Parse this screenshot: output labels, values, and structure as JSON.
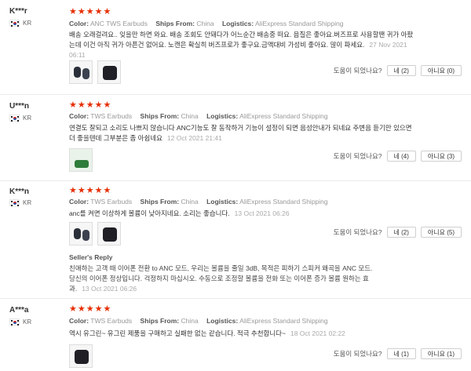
{
  "labels": {
    "color": "Color:",
    "ships_from": "Ships From:",
    "logistics": "Logistics:",
    "helpful_question": "도움이 되었나요?",
    "seller_reply": "Seller's Reply",
    "stars": "★★★★★"
  },
  "reviews": [
    {
      "user": "K***r",
      "country": "KR",
      "rating": 5,
      "color": "ANC TWS Earbuds",
      "ships_from": "China",
      "logistics": "AliExpress Standard Shipping",
      "text": "배송 오래걸려요.. 잊을만 하면 와요. 배송 조회도 안돼다가 어느순간 배송중 떠요. 음질은 좋아요.버즈프로 사용할땐 귀가 아팠는데 이건 아직 귀가 아픈건 없어요. 노캔은 확실히 버즈프로가 좋구요.금액대비 가성비 좋아요. 많이 파세요.",
      "date": "27 Nov 2021 06:11",
      "yes": "네 (2)",
      "no": "아니요 (0)"
    },
    {
      "user": "U***n",
      "country": "KR",
      "rating": 5,
      "color": "TWS Earbuds",
      "ships_from": "China",
      "logistics": "AliExpress Standard Shipping",
      "text": "연결도 잘되고 소리도 나쁘지 않습니다 ANC기능도 잘 동작하거 기능이 설정이 되면 음성안내가 되네요 주변음 듣기만 있으면 더 좋을텐데 그부분은 좀 아쉽네요",
      "date": "12 Oct 2021 21:41",
      "yes": "네 (4)",
      "no": "아니요 (3)"
    },
    {
      "user": "K***n",
      "country": "KR",
      "rating": 5,
      "color": "TWS Earbuds",
      "ships_from": "China",
      "logistics": "AliExpress Standard Shipping",
      "text": "anc를 켜면 이상하게 볼륨이 낮아지네요. 소리는 좋습니다.",
      "date": "13 Oct 2021 06:26",
      "yes": "네 (2)",
      "no": "아니요 (5)",
      "seller_reply": "친애하는 고객 때 이어폰 전환 to ANC 모드, 우리는 볼륨을 줄일 3dB, 목적은 피하기 스피커 왜곡을 ANC 모드. 당신의 이어폰 정상입니다. 걱정하지 마십시오. 수동으로 조정할 볼륨을 전화 또는 이어폰 증가 볼륨 원하는 효과.",
      "seller_date": "13 Oct 2021 06:26"
    },
    {
      "user": "A***a",
      "country": "KR",
      "rating": 5,
      "color": "TWS Earbuds",
      "ships_from": "China",
      "logistics": "AliExpress Standard Shipping",
      "text": "역시 유그린~ 유그린 제품을 구매하고 실패한 없는 같습니다. 적극 추천합니다~",
      "date": "18 Oct 2021 02:22",
      "yes": "네 (1)",
      "no": "아니요 (1)"
    }
  ]
}
